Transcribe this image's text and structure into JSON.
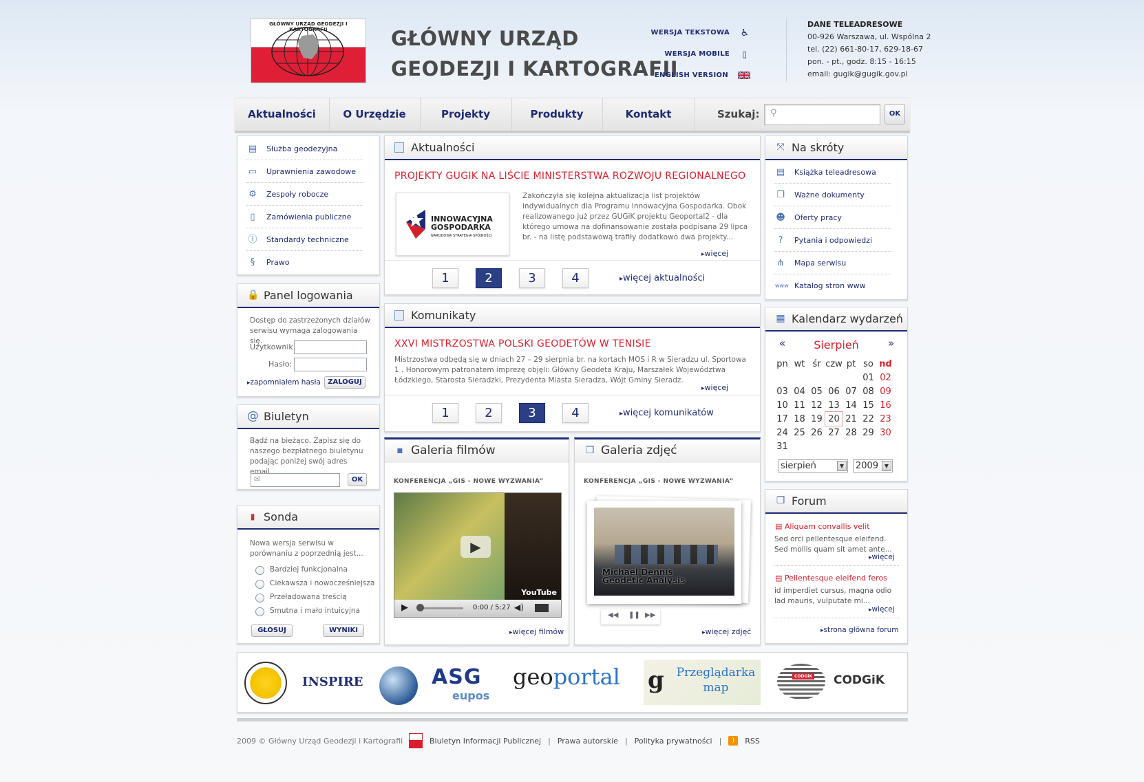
{
  "header": {
    "logo_caption": "GŁÓWNY URZĄD GEODEZJI I KARTOGRAFII",
    "title_line1": "GŁÓWNY URZĄD",
    "title_line2": "GEODEZJI I KARTOGRAFII",
    "links": [
      {
        "label": "WERSJA TEKSTOWA",
        "icon": "accessibility-icon"
      },
      {
        "label": "WERSJA MOBILE",
        "icon": "mobile-phone-icon"
      },
      {
        "label": "ENGLISH VERSION",
        "icon": "uk-flag-icon"
      }
    ],
    "contact": {
      "heading": "DANE TELEADRESOWE",
      "address": "00-926 Warszawa, ul. Wspólna 2",
      "phone": "tel. (22) 661-80-17, 629-18-67",
      "hours": "pon. - pt., godz. 8:15 - 16:15",
      "email": "email: gugik@gugik.gov.pl"
    }
  },
  "nav": {
    "items": [
      "Aktualności",
      "O Urzędzie",
      "Projekty",
      "Produkty",
      "Kontakt"
    ],
    "search_label": "Szukaj:",
    "search_placeholder": "",
    "search_button": "OK"
  },
  "sidebar_menu": [
    {
      "label": "Służba geodezyjna",
      "icon": "surveyor-icon"
    },
    {
      "label": "Uprawnienia zawodowe",
      "icon": "book-icon"
    },
    {
      "label": "Zespoły robocze",
      "icon": "gear-icon"
    },
    {
      "label": "Zamówienia publiczne",
      "icon": "document-icon"
    },
    {
      "label": "Standardy techniczne",
      "icon": "info-icon"
    },
    {
      "label": "Prawo",
      "icon": "paragraph-icon"
    }
  ],
  "login": {
    "title": "Panel logowania",
    "intro": "Dostęp do zastrzeżonych działów serwisu wymaga zalogowania się.",
    "user_label": "Użytkownik:",
    "password_label": "Hasło:",
    "forgot": "zapomniałem hasła",
    "button": "ZALOGUJ"
  },
  "newsletter": {
    "title": "Biuletyn",
    "text": "Bądź na bieżąco. Zapisz się do naszego bezpłatnego biuletynu podając poniżej swój adres email.",
    "button": "OK"
  },
  "poll": {
    "title": "Sonda",
    "question": "Nowa wersja serwisu w porównaniu z poprzednią jest...",
    "options": [
      "Bardziej funkcjonalna",
      "Ciekawsza i nowocześniejsza",
      "Przeładowana treścią",
      "Smutna i mało intuicyjna"
    ],
    "vote_button": "GŁOSUJ",
    "results_button": "WYNIKI"
  },
  "news": {
    "title": "Aktualności",
    "headline": "PROJEKTY GUGIK NA LIŚCIE MINISTERSTWA ROZWOJU REGIONALNEGO",
    "image_text1": "INNOWACYJNA",
    "image_text2": "GOSPODARKA",
    "image_text3": "NARODOWA STRATEGIA SPÓJNOŚCI",
    "body": "Zakończyła się kolejna aktualizacja list projektów indywidualnych dla Programu Innowacyjna Gospodarka. Obok realizowanego już przez GUGiK projektu Geoportal2 - dla którego umowa na dofinansowanie została podpisana 29 lipca br. - na listę podstawową trafiły dodatkowo dwa projekty...",
    "more": "więcej",
    "pages": [
      "1",
      "2",
      "3",
      "4"
    ],
    "active_page": "2",
    "more_all": "więcej aktualności"
  },
  "announcements": {
    "title": "Komunikaty",
    "headline": "XXVI MISTRZOSTWA POLSKI GEODETÓW W TENISIE",
    "body": "Mistrzostwa odbędą się w dniach 27 – 29 sierpnia br. na kortach MOS i R w Sieradzu ul. Sportowa 1 . Honorowym patronatem imprezę objęli: Główny Geodeta Kraju, Marszałek Województwa Łódzkiego, Starosta Sieradzki, Prezydenta Miasta Sieradza, Wójt Gminy Sieradz.",
    "more": "więcej",
    "pages": [
      "1",
      "2",
      "3",
      "4"
    ],
    "active_page": "3",
    "more_all": "więcej komunikatów"
  },
  "videos": {
    "title": "Galeria filmów",
    "subtitle": "KONFERENCJA „GIS - NOWE WYZWANIA”",
    "time": "0:00 / 5:27",
    "watermark": "YouTube",
    "more": "więcej filmów"
  },
  "photos": {
    "title": "Galeria zdjęć",
    "subtitle": "KONFERENCJA „GIS - NOWE WYZWANIA”",
    "caption1": "Michael Dennis",
    "caption2": "Geodetic Analysis",
    "more": "więcej zdjęć"
  },
  "shortcuts": {
    "title": "Na skróty",
    "items": [
      {
        "label": "Książka teleadresowa",
        "icon": "phonebook-icon"
      },
      {
        "label": "Ważne dokumenty",
        "icon": "documents-icon"
      },
      {
        "label": "Oferty pracy",
        "icon": "person-icon"
      },
      {
        "label": "Pytania i odpowiedzi",
        "icon": "question-icon"
      },
      {
        "label": "Mapa serwisu",
        "icon": "sitemap-icon"
      },
      {
        "label": "Katalog stron www",
        "icon": "www-icon"
      }
    ]
  },
  "calendar": {
    "title": "Kalendarz wydarzeń",
    "month": "Sierpień",
    "prev": "«",
    "next": "»",
    "weekdays": [
      "pn",
      "wt",
      "śr",
      "czw",
      "pt",
      "so",
      "nd"
    ],
    "weeks": [
      [
        "",
        "",
        "",
        "",
        "",
        "01",
        "02"
      ],
      [
        "03",
        "04",
        "05",
        "06",
        "07",
        "08",
        "09"
      ],
      [
        "10",
        "11",
        "12",
        "13",
        "14",
        "15",
        "16"
      ],
      [
        "17",
        "18",
        "19",
        "20",
        "21",
        "22",
        "23"
      ],
      [
        "24",
        "25",
        "26",
        "27",
        "28",
        "29",
        "30"
      ],
      [
        "31",
        "",
        "",
        "",
        "",
        "",
        ""
      ]
    ],
    "today": "20",
    "month_select": "sierpień",
    "year_select": "2009"
  },
  "forum": {
    "title": "Forum",
    "posts": [
      {
        "title": "Aliquam convallis velit",
        "text": "Sed orci pellentesque eleifend. Sed mollis quam sit amet ante...",
        "more": "więcej"
      },
      {
        "title": "Pellentesque eleifend feros",
        "text": "id imperdiet cursus, magna odio lad mauris, vulputate mi...",
        "more": "więcej"
      }
    ],
    "main_link": "strona główna forum"
  },
  "partners": {
    "inspire": "INSPIRE",
    "asg": "ASG",
    "asg_sub": "eupos",
    "geoportal_a": "geo",
    "geoportal_b": "portal",
    "viewer_1": "Przeglądarka",
    "viewer_2": "map",
    "codgik": "CODGiK",
    "codgik_badge": "CODGiK"
  },
  "footer": {
    "copyright": "2009 © Główny Urząd Geodezji i Kartografii",
    "links": [
      "Biuletyn Informacji Publicznej",
      "Prawa autorskie",
      "Polityka prywatności",
      "RSS"
    ],
    "separator": "|"
  },
  "colors": {
    "navy": "#1e2a74",
    "red": "#e11e2c",
    "accent_blue": "#2b3f85"
  }
}
